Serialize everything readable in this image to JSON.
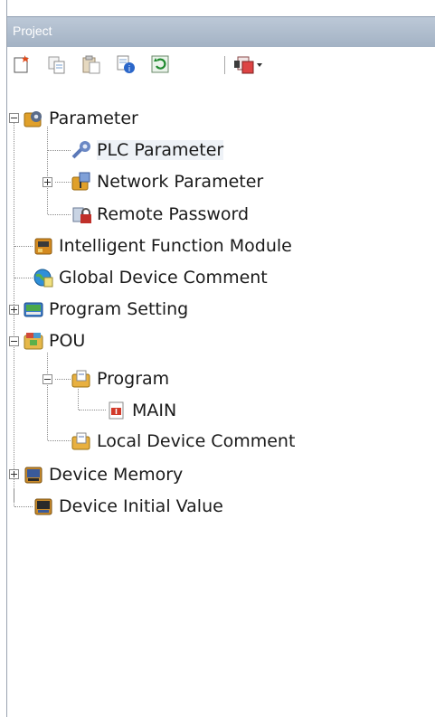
{
  "panel": {
    "title": "Project"
  },
  "toolbar": {
    "buttons": [
      {
        "icon": "new-data-icon"
      },
      {
        "icon": "copy-icon"
      },
      {
        "icon": "paste-icon"
      },
      {
        "icon": "property-icon"
      },
      {
        "icon": "refresh-icon"
      },
      {
        "icon": "data-dropdown-icon"
      }
    ]
  },
  "tree": {
    "parameter": "Parameter",
    "plc_parameter": "PLC Parameter",
    "network_parameter": "Network Parameter",
    "remote_password": "Remote Password",
    "intelligent_function_module": "Intelligent Function Module",
    "global_device_comment": "Global Device Comment",
    "program_setting": "Program Setting",
    "pou": "POU",
    "program": "Program",
    "main": "MAIN",
    "local_device_comment": "Local Device Comment",
    "device_memory": "Device Memory",
    "device_initial_value": "Device Initial Value"
  },
  "colors": {
    "title_bar": "#a3b2c4",
    "tree_line": "#8c8c8c"
  }
}
